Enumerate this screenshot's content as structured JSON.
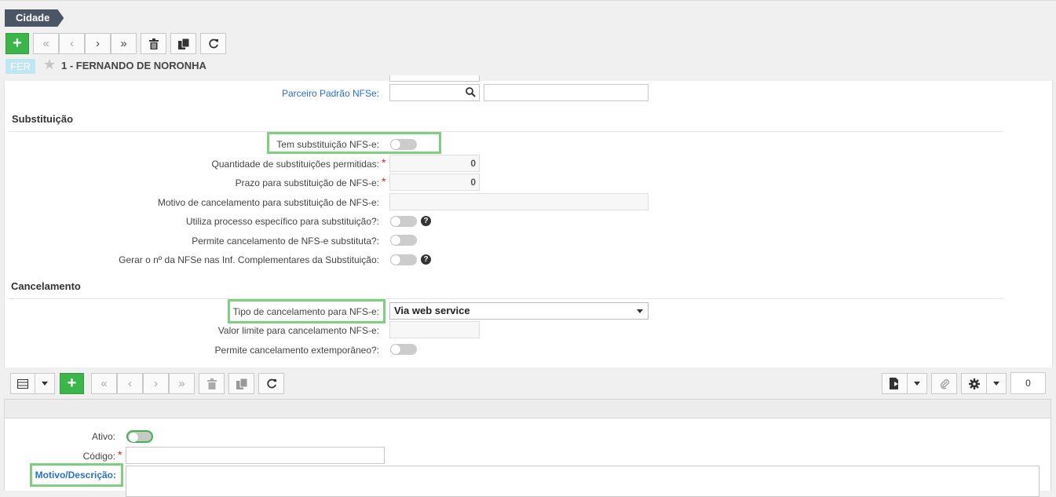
{
  "breadcrumb": "Cidade",
  "record": {
    "badge": "FER",
    "title": "1 - FERNANDO DE NORONHA"
  },
  "top_toolbar": {
    "add": "+",
    "first": "«",
    "prev": "‹",
    "next": "›",
    "last": "»",
    "delete_icon": "trash-icon",
    "copy_icon": "copy-icon",
    "refresh_icon": "refresh-icon"
  },
  "form": {
    "parceiro_label": "Parceiro Padrão NFSe:",
    "sec_substituicao": "Substituição",
    "tem_substituicao_label": "Tem substituição NFS-e:",
    "qtd_substituicoes_label": "Quantidade de substituições permitidas:",
    "qtd_substituicoes_value": "0",
    "prazo_label": "Prazo para substituição de NFS-e:",
    "prazo_value": "0",
    "motivo_cancel_label": "Motivo de cancelamento para substituição de NFS-e:",
    "utiliza_processo_label": "Utiliza processo específico para substituição?:",
    "permite_cancel_label": "Permite cancelamento de NFS-e substituta?:",
    "gerar_no_label": "Gerar o nº da NFSe nas Inf. Complementares da Substituição:",
    "sec_cancelamento": "Cancelamento",
    "tipo_cancel_label": "Tipo de cancelamento para NFS-e:",
    "tipo_cancel_value": "Via web service",
    "valor_limite_label": "Valor limite para cancelamento NFS-e:",
    "permite_extemp_label": "Permite cancelamento extemporâneo?:",
    "help_glyph": "?",
    "required_mark": "*"
  },
  "grid_toolbar": {
    "add": "+",
    "first": "«",
    "prev": "‹",
    "next": "›",
    "last": "»",
    "count": "0"
  },
  "detail_form": {
    "ativo_label": "Ativo:",
    "codigo_label": "Código:",
    "motivo_label": "Motivo/Descrição:"
  },
  "colors": {
    "accent_green": "#3cb54a",
    "highlight_green": "#7ed07e",
    "link_blue": "#2a6fc9",
    "required_red": "#d9261c"
  }
}
